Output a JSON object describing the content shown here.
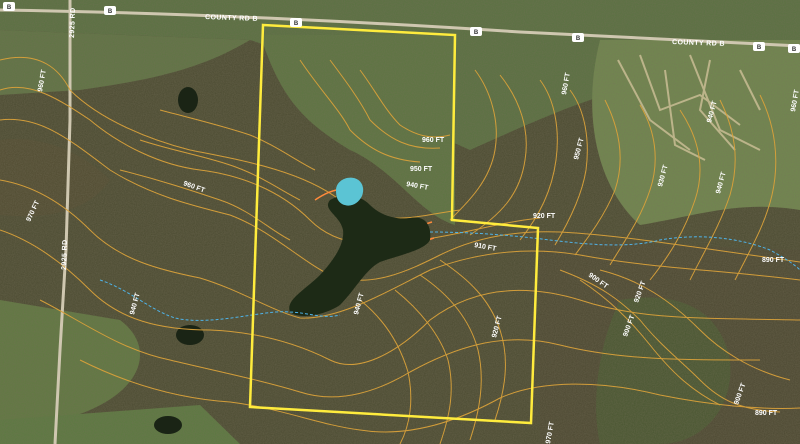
{
  "map": {
    "roads": [
      {
        "id": "county-rd-b-west",
        "label": "COUNTY RD B"
      },
      {
        "id": "county-rd-b-east",
        "label": "COUNTY RD B"
      },
      {
        "id": "road-2925-north",
        "label": "2925 RD"
      },
      {
        "id": "road-2925-south",
        "label": "2925 RD"
      }
    ],
    "route_badges": [
      "B",
      "B",
      "B",
      "B",
      "B",
      "B",
      "B"
    ],
    "contours": [
      {
        "label": "960 FT"
      },
      {
        "label": "960 FT"
      },
      {
        "label": "960 FT"
      },
      {
        "label": "960 FT"
      },
      {
        "label": "960 FT"
      },
      {
        "label": "950 FT"
      },
      {
        "label": "950 FT"
      },
      {
        "label": "940 FT"
      },
      {
        "label": "940 FT"
      },
      {
        "label": "940 FT"
      },
      {
        "label": "940 FT"
      },
      {
        "label": "940 FT"
      },
      {
        "label": "930 FT"
      },
      {
        "label": "920 FT"
      },
      {
        "label": "920 FT"
      },
      {
        "label": "920 FT"
      },
      {
        "label": "910 FT"
      },
      {
        "label": "900 FT"
      },
      {
        "label": "900 FT"
      },
      {
        "label": "900 FT"
      },
      {
        "label": "890 FT"
      },
      {
        "label": "890 FT"
      },
      {
        "label": "970 FT"
      },
      {
        "label": "970 FT"
      }
    ],
    "colors": {
      "boundary": "#ffec3d",
      "contour": "#d9a13a",
      "contour_highlight": "#ff8a3c",
      "pond": "#5bc4d4",
      "lake": "#1d2a16",
      "creek": "#4fb3e8",
      "road": "#cfc7b0"
    }
  }
}
